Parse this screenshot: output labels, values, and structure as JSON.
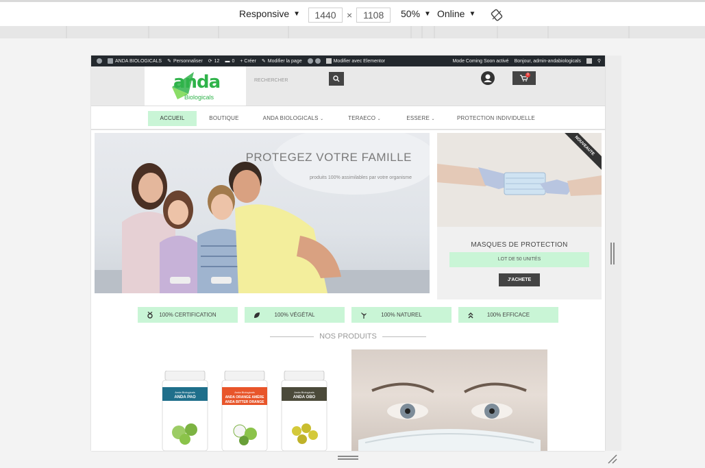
{
  "devtools": {
    "device": "Responsive",
    "width": "1440",
    "height": "1108",
    "times": "×",
    "zoom": "50%",
    "throttle": "Online"
  },
  "adminbar": {
    "site_name": "ANDA BIOLOGICALS",
    "customize": "Personnaliser",
    "updates": "12",
    "comments": "0",
    "new": "+ Créer",
    "edit": "Modifier la page",
    "elementor": "Modifier avec Elementor",
    "coming_soon": "Mode Coming Soon activé",
    "greeting": "Bonjour, admin-andabiologicals"
  },
  "header": {
    "logo_main": "anda",
    "logo_sub": "Biologicals",
    "search_placeholder": "RECHERCHER",
    "cart_count": "0"
  },
  "nav": {
    "items": [
      {
        "label": "ACCUEIL"
      },
      {
        "label": "BOUTIQUE"
      },
      {
        "label": "ANDA BIOLOGICALS"
      },
      {
        "label": "TERAECO"
      },
      {
        "label": "ESSERE"
      },
      {
        "label": "PROTECTION INDIVIDUELLE"
      }
    ]
  },
  "hero": {
    "title": "PROTEGEZ VOTRE FAMILLE",
    "subtitle": "produits 100% assimilables par votre organisme"
  },
  "promo": {
    "ribbon": "NOUVEAUTE",
    "title": "MASQUES DE PROTECTION",
    "badge": "LOT DE 50 UNITÉS",
    "button": "J'ACHETE"
  },
  "features": [
    {
      "label": "100% CERTIFICATION",
      "icon": "medal-icon"
    },
    {
      "label": "100% VÉGÉTAL",
      "icon": "leaf-icon"
    },
    {
      "label": "100% NATUREL",
      "icon": "plant-icon"
    },
    {
      "label": "100% EFFICACE",
      "icon": "double-chevron-up-icon"
    }
  ],
  "section": {
    "products_title": "NOS PRODUITS"
  },
  "products": [
    {
      "brand": "Anda Biologicals",
      "name": "ANDA PAO",
      "color": "#1f6f8b"
    },
    {
      "brand": "Anda Biologicals",
      "name": "ANDA ORANGE AMÈRE",
      "name2": "ANDA BITTER ORANGE",
      "color": "#e8552a"
    },
    {
      "brand": "Anda Biologicals",
      "name": "ANDA OBO",
      "color": "#4b4a3a"
    }
  ],
  "colors": {
    "accent_green": "#c9f5d6",
    "logo_green": "#2fb34a",
    "dark": "#444444",
    "adminbar": "#23282d"
  }
}
